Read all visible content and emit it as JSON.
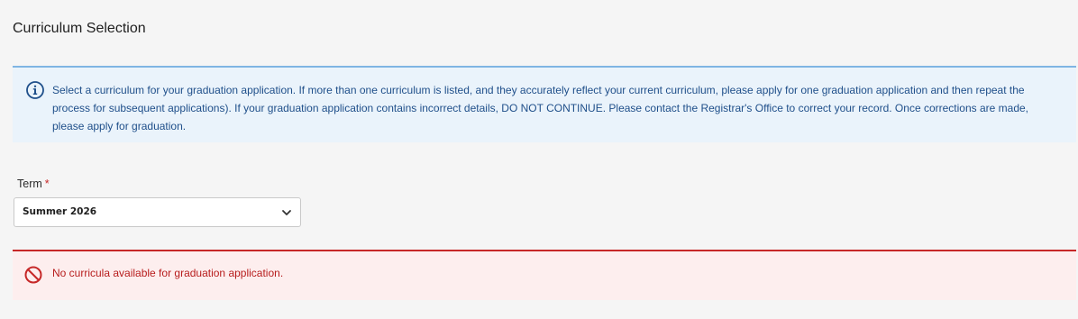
{
  "page": {
    "title": "Curriculum Selection"
  },
  "info": {
    "icon": "info-icon",
    "message": "Select a curriculum for your graduation application. If more than one curriculum is listed, and they accurately reflect your current curriculum, please apply for one graduation application and then repeat the process for subsequent applications). If your graduation application contains incorrect details, DO NOT CONTINUE. Please contact the Registrar's Office to correct your record. Once corrections are made, please apply for graduation.",
    "accent_color": "#7fb5e3",
    "background_color": "#eaf3fb"
  },
  "term": {
    "label": "Term",
    "required_marker": "*",
    "selected_value": "Summer 2026",
    "dropdown_icon": "chevron-down-icon"
  },
  "error": {
    "icon": "prohibited-icon",
    "message": "No curricula available for graduation application.",
    "accent_color": "#c62828",
    "background_color": "#fdeeee"
  }
}
